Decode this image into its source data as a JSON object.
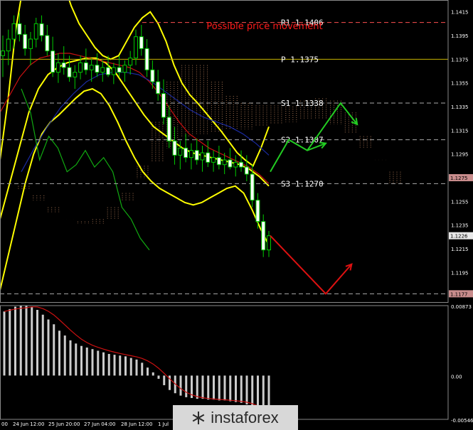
{
  "chart_data": {
    "type": "candlestick",
    "title": "Possible price movement",
    "levels": [
      {
        "label": "R1 1.1406",
        "value": 1.1406,
        "color": "#ff5050",
        "style": "dashed"
      },
      {
        "label": "P 1.1375",
        "value": 1.1375,
        "color": "#c8b400",
        "style": "solid"
      },
      {
        "label": "S1 1.1338",
        "value": 1.1338,
        "color": "#aaaaaa",
        "style": "dashed"
      },
      {
        "label": "S2 1.1307",
        "value": 1.1307,
        "color": "#aaaaaa",
        "style": "dashed"
      },
      {
        "label": "S3 1.1270",
        "value": 1.127,
        "color": "#aaaaaa",
        "style": "dashed"
      },
      {
        "label": "",
        "value": 1.1177,
        "color": "#aaaaaa",
        "style": "dashed"
      }
    ],
    "price_axis": {
      "ticks": [
        1.1415,
        1.1395,
        1.1375,
        1.1355,
        1.1335,
        1.1315,
        1.1295,
        1.1275,
        1.1255,
        1.1235,
        1.1215,
        1.1195,
        1.1177
      ],
      "highlight": [
        {
          "label": "1.1275",
          "value": 1.1275,
          "bg": "#c88c8c"
        },
        {
          "label": "1.1226",
          "value": 1.1226,
          "bg": "#e8e8e8"
        },
        {
          "label": "1.1177",
          "value": 1.1177,
          "bg": "#c88c8c"
        }
      ],
      "ylim": [
        1.117,
        1.1425
      ]
    },
    "time_axis": [
      "00",
      "24 Jun 12:00",
      "25 Jun 20:00",
      "27 Jun 04:00",
      "28 Jun 12:00",
      "1 Jul"
    ],
    "osc_axis": {
      "ticks": [
        "0.00873",
        "0.00",
        "-0.00546"
      ],
      "ylim": [
        -0.00546,
        0.00873
      ]
    },
    "candles": [
      [
        1.1378,
        1.1395,
        1.136,
        1.1382
      ],
      [
        1.1382,
        1.14,
        1.137,
        1.1392
      ],
      [
        1.1392,
        1.1412,
        1.1384,
        1.1405
      ],
      [
        1.1405,
        1.1414,
        1.139,
        1.1396
      ],
      [
        1.1396,
        1.1404,
        1.1378,
        1.1384
      ],
      [
        1.1384,
        1.1398,
        1.137,
        1.1392
      ],
      [
        1.1392,
        1.141,
        1.1385,
        1.1405
      ],
      [
        1.1405,
        1.1412,
        1.139,
        1.1395
      ],
      [
        1.1395,
        1.1404,
        1.1378,
        1.1382
      ],
      [
        1.1382,
        1.1394,
        1.136,
        1.1364
      ],
      [
        1.1364,
        1.138,
        1.1355,
        1.1372
      ],
      [
        1.1372,
        1.1386,
        1.1362,
        1.1368
      ],
      [
        1.1368,
        1.1378,
        1.1356,
        1.136
      ],
      [
        1.136,
        1.137,
        1.135,
        1.1364
      ],
      [
        1.1364,
        1.1378,
        1.1358,
        1.1372
      ],
      [
        1.1372,
        1.1384,
        1.1362,
        1.1366
      ],
      [
        1.1366,
        1.1376,
        1.1356,
        1.137
      ],
      [
        1.137,
        1.138,
        1.136,
        1.1364
      ],
      [
        1.1364,
        1.1374,
        1.1356,
        1.1368
      ],
      [
        1.1368,
        1.1378,
        1.136,
        1.1362
      ],
      [
        1.1362,
        1.1372,
        1.1354,
        1.1368
      ],
      [
        1.1368,
        1.1378,
        1.136,
        1.1364
      ],
      [
        1.1364,
        1.1374,
        1.1356,
        1.137
      ],
      [
        1.137,
        1.1382,
        1.1362,
        1.1376
      ],
      [
        1.1376,
        1.14,
        1.137,
        1.1394
      ],
      [
        1.1394,
        1.1404,
        1.1378,
        1.1384
      ],
      [
        1.1384,
        1.1392,
        1.136,
        1.1366
      ],
      [
        1.1366,
        1.1374,
        1.135,
        1.1356
      ],
      [
        1.1356,
        1.1366,
        1.134,
        1.1346
      ],
      [
        1.1346,
        1.1358,
        1.132,
        1.1326
      ],
      [
        1.1326,
        1.1336,
        1.13,
        1.1306
      ],
      [
        1.1306,
        1.1318,
        1.1286,
        1.1294
      ],
      [
        1.1294,
        1.1306,
        1.1282,
        1.13
      ],
      [
        1.13,
        1.1312,
        1.1288,
        1.1292
      ],
      [
        1.1292,
        1.1304,
        1.1282,
        1.1298
      ],
      [
        1.1298,
        1.1308,
        1.1286,
        1.129
      ],
      [
        1.129,
        1.1302,
        1.128,
        1.1296
      ],
      [
        1.1296,
        1.1306,
        1.1284,
        1.1288
      ],
      [
        1.1288,
        1.1298,
        1.128,
        1.1292
      ],
      [
        1.1292,
        1.1302,
        1.1282,
        1.1286
      ],
      [
        1.1286,
        1.1296,
        1.1278,
        1.129
      ],
      [
        1.129,
        1.13,
        1.1282,
        1.1284
      ],
      [
        1.1284,
        1.1294,
        1.1276,
        1.1288
      ],
      [
        1.1288,
        1.1298,
        1.128,
        1.1284
      ],
      [
        1.1284,
        1.1294,
        1.1272,
        1.1278
      ],
      [
        1.1278,
        1.1286,
        1.125,
        1.1256
      ],
      [
        1.1256,
        1.1262,
        1.1232,
        1.1238
      ],
      [
        1.1238,
        1.1244,
        1.1208,
        1.1214
      ],
      [
        1.1214,
        1.123,
        1.1208,
        1.1226
      ]
    ],
    "oscillator": [
      0.008,
      0.0083,
      0.0086,
      0.0087,
      0.0087,
      0.0086,
      0.0082,
      0.0076,
      0.007,
      0.0064,
      0.0056,
      0.005,
      0.0044,
      0.004,
      0.0037,
      0.0035,
      0.0033,
      0.0031,
      0.0029,
      0.0027,
      0.0026,
      0.0025,
      0.0024,
      0.0022,
      0.002,
      0.0016,
      0.001,
      0.0004,
      -0.0004,
      -0.0012,
      -0.0018,
      -0.0022,
      -0.0025,
      -0.0027,
      -0.0028,
      -0.0029,
      -0.0029,
      -0.003,
      -0.003,
      -0.0031,
      -0.0031,
      -0.0032,
      -0.0033,
      -0.0034,
      -0.0036,
      -0.004,
      -0.0046,
      -0.005,
      -0.0054
    ],
    "indicators": {
      "bollinger_upper": [
        1.129,
        1.134,
        1.14,
        1.144,
        1.1462,
        1.147,
        1.1465,
        1.1455,
        1.144,
        1.142,
        1.1405,
        1.1395,
        1.1385,
        1.1378,
        1.1375,
        1.1378,
        1.139,
        1.1402,
        1.141,
        1.1415,
        1.1405,
        1.139,
        1.137,
        1.1355,
        1.1345,
        1.1338,
        1.133,
        1.1322,
        1.1314,
        1.1305,
        1.1296,
        1.129,
        1.1285,
        1.13,
        1.1318
      ],
      "bollinger_lower": [
        1.118,
        1.121,
        1.124,
        1.127,
        1.1295,
        1.1312,
        1.1322,
        1.1328,
        1.1335,
        1.1342,
        1.1348,
        1.135,
        1.1346,
        1.1336,
        1.1322,
        1.1306,
        1.1292,
        1.128,
        1.1272,
        1.1266,
        1.1262,
        1.1258,
        1.1254,
        1.1252,
        1.1254,
        1.1258,
        1.1262,
        1.1266,
        1.1268,
        1.1262,
        1.1248,
        1.1232,
        1.1218
      ],
      "bollinger_middle": [
        1.124,
        1.127,
        1.13,
        1.133,
        1.135,
        1.1362,
        1.1368,
        1.1372,
        1.1374,
        1.1376,
        1.1376,
        1.1372,
        1.1364,
        1.1352,
        1.134,
        1.1328,
        1.1318,
        1.1312,
        1.1306,
        1.13,
        1.1296,
        1.1294,
        1.1292,
        1.129,
        1.1288,
        1.1286,
        1.1282,
        1.1276,
        1.1268
      ],
      "ma_red": [
        1.133,
        1.1345,
        1.136,
        1.137,
        1.1376,
        1.1378,
        1.138,
        1.138,
        1.1378,
        1.1376,
        1.1374,
        1.1372,
        1.137,
        1.1368,
        1.1364,
        1.1356,
        1.1346,
        1.1334,
        1.1322,
        1.1312,
        1.1306,
        1.13,
        1.1296,
        1.1292,
        1.1288,
        1.1284,
        1.1278,
        1.127
      ],
      "ma_blue": [
        1.128,
        1.13,
        1.1318,
        1.1334,
        1.1346,
        1.1356,
        1.1362,
        1.1364,
        1.1364,
        1.1362,
        1.1356,
        1.1348,
        1.134,
        1.1332,
        1.1326,
        1.1322,
        1.1318,
        1.1312,
        1.1304,
        1.1294
      ],
      "chikou_green": [
        1.135,
        1.133,
        1.129,
        1.131,
        1.13,
        1.128,
        1.1286,
        1.1298,
        1.1284,
        1.1292,
        1.128,
        1.125,
        1.124,
        1.1224,
        1.1214
      ],
      "cloud_a": [
        1.1275,
        1.1268,
        1.126,
        1.125,
        1.124,
        1.1236,
        1.1236,
        1.124,
        1.1256,
        1.1285,
        1.1322,
        1.1356,
        1.137,
        1.137,
        1.1356,
        1.1344,
        1.1338,
        1.1336,
        1.1336,
        1.1335,
        1.134,
        1.1342,
        1.134,
        1.133,
        1.131,
        1.129,
        1.127
      ],
      "cloud_b": [
        1.1275,
        1.1265,
        1.1256,
        1.1246,
        1.124,
        1.1238,
        1.124,
        1.125,
        1.1262,
        1.1274,
        1.1288,
        1.13,
        1.131,
        1.1312,
        1.1314,
        1.1316,
        1.1316,
        1.1318,
        1.132,
        1.1322,
        1.1324,
        1.1324,
        1.132,
        1.1312,
        1.13,
        1.129,
        1.128
      ]
    },
    "scenarios": [
      {
        "name": "",
        "color": "#22cc22",
        "points": [
          [
            0,
            1.128
          ],
          [
            1,
            1.1307
          ],
          [
            2,
            1.1298
          ],
          [
            3,
            1.1304
          ]
        ]
      },
      {
        "name": "",
        "color": "#22cc22",
        "points": [
          [
            2,
            1.1298
          ],
          [
            3.8,
            1.1338
          ],
          [
            4.7,
            1.132
          ]
        ]
      },
      {
        "name": "",
        "color": "#dd1111",
        "points": [
          [
            0,
            1.1226
          ],
          [
            3,
            1.1177
          ],
          [
            4.4,
            1.1202
          ]
        ]
      }
    ]
  },
  "brand": {
    "name": "instaforex"
  },
  "colors": {
    "background": "#000000",
    "bull": "#00cc00",
    "bear": "#ffffff",
    "band": "#ffff00"
  }
}
